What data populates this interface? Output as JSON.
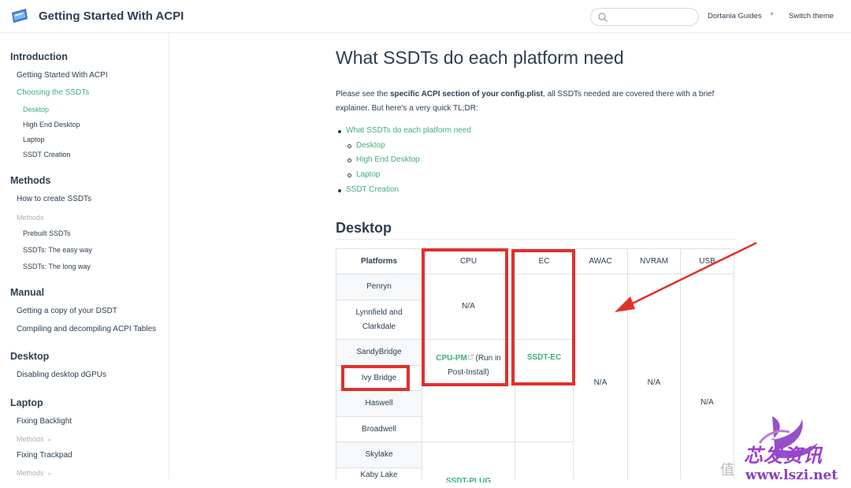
{
  "header": {
    "site_title": "Getting Started With ACPI",
    "nav_guides": "Dortania Guides",
    "nav_theme": "Switch theme"
  },
  "sidebar": {
    "introduction": "Introduction",
    "getting_started": "Getting Started With ACPI",
    "choosing": "Choosing the SSDTs",
    "desktop_sub": "Desktop",
    "hedt_sub": "High End Desktop",
    "laptop_sub": "Laptop",
    "ssdt_creation_sub": "SSDT Creation",
    "methods_h": "Methods",
    "how_to_create": "How to create SSDTs",
    "methods_muted": "Methods",
    "prebuilt": "Prebuilt SSDTs",
    "easy_way": "SSDTs: The easy way",
    "long_way": "SSDTs: The long way",
    "manual_h": "Manual",
    "copy_dsdt": "Getting a copy of your DSDT",
    "compiling": "Compiling and decompiling ACPI Tables",
    "desktop_h": "Desktop",
    "disabling_dgpu": "Disabling desktop dGPUs",
    "laptop_h": "Laptop",
    "fixing_backlight": "Fixing Backlight",
    "methods_muted2": "Methods",
    "fixing_trackpad": "Fixing Trackpad",
    "methods_muted3": "Methods"
  },
  "main": {
    "title": "What SSDTs do each platform need",
    "para_pre": "Please see the ",
    "para_bold": "specific ACPI section of your config.plist",
    "para_post": ", all SSDTs needed are covered there with a brief explainer. But here's a very quick TL;DR:",
    "toc": {
      "t1": "What SSDTs do each platform need",
      "t2": "Desktop",
      "t3": "High End Desktop",
      "t4": "Laptop",
      "t5": "SSDT Creation"
    },
    "section_desktop": "Desktop"
  },
  "table": {
    "headers": {
      "platforms": "Platforms",
      "cpu": "CPU",
      "ec": "EC",
      "awac": "AWAC",
      "nvram": "NVRAM",
      "usb": "USB"
    },
    "platforms": {
      "p1": "Penryn",
      "p2a": "Lynnfield and",
      "p2b": "Clarkdale",
      "p3": "SandyBridge",
      "p4": "Ivy Bridge",
      "p5": "Haswell",
      "p6": "Broadwell",
      "p7": "Skylake",
      "p8": "Kaby Lake"
    },
    "cpu_na": "N/A",
    "cpu_pm_link": "CPU-PM",
    "cpu_pm_rest1": " (Run in",
    "cpu_pm_rest2": "Post-Install)",
    "ec_link": "SSDT-EC",
    "awac_na": "N/A",
    "nvram_na": "N/A",
    "usb_na": "N/A",
    "cpu_plug_partial": "SSDT-PLUG"
  },
  "watermark": {
    "cn": "芯发资讯",
    "zhi": "值",
    "url": "www.lszi.net"
  },
  "colors": {
    "accent": "#3eaf7c",
    "text": "#2c3e50",
    "highlight_red": "#e1302c",
    "watermark_purple": "#8a3fc0"
  }
}
